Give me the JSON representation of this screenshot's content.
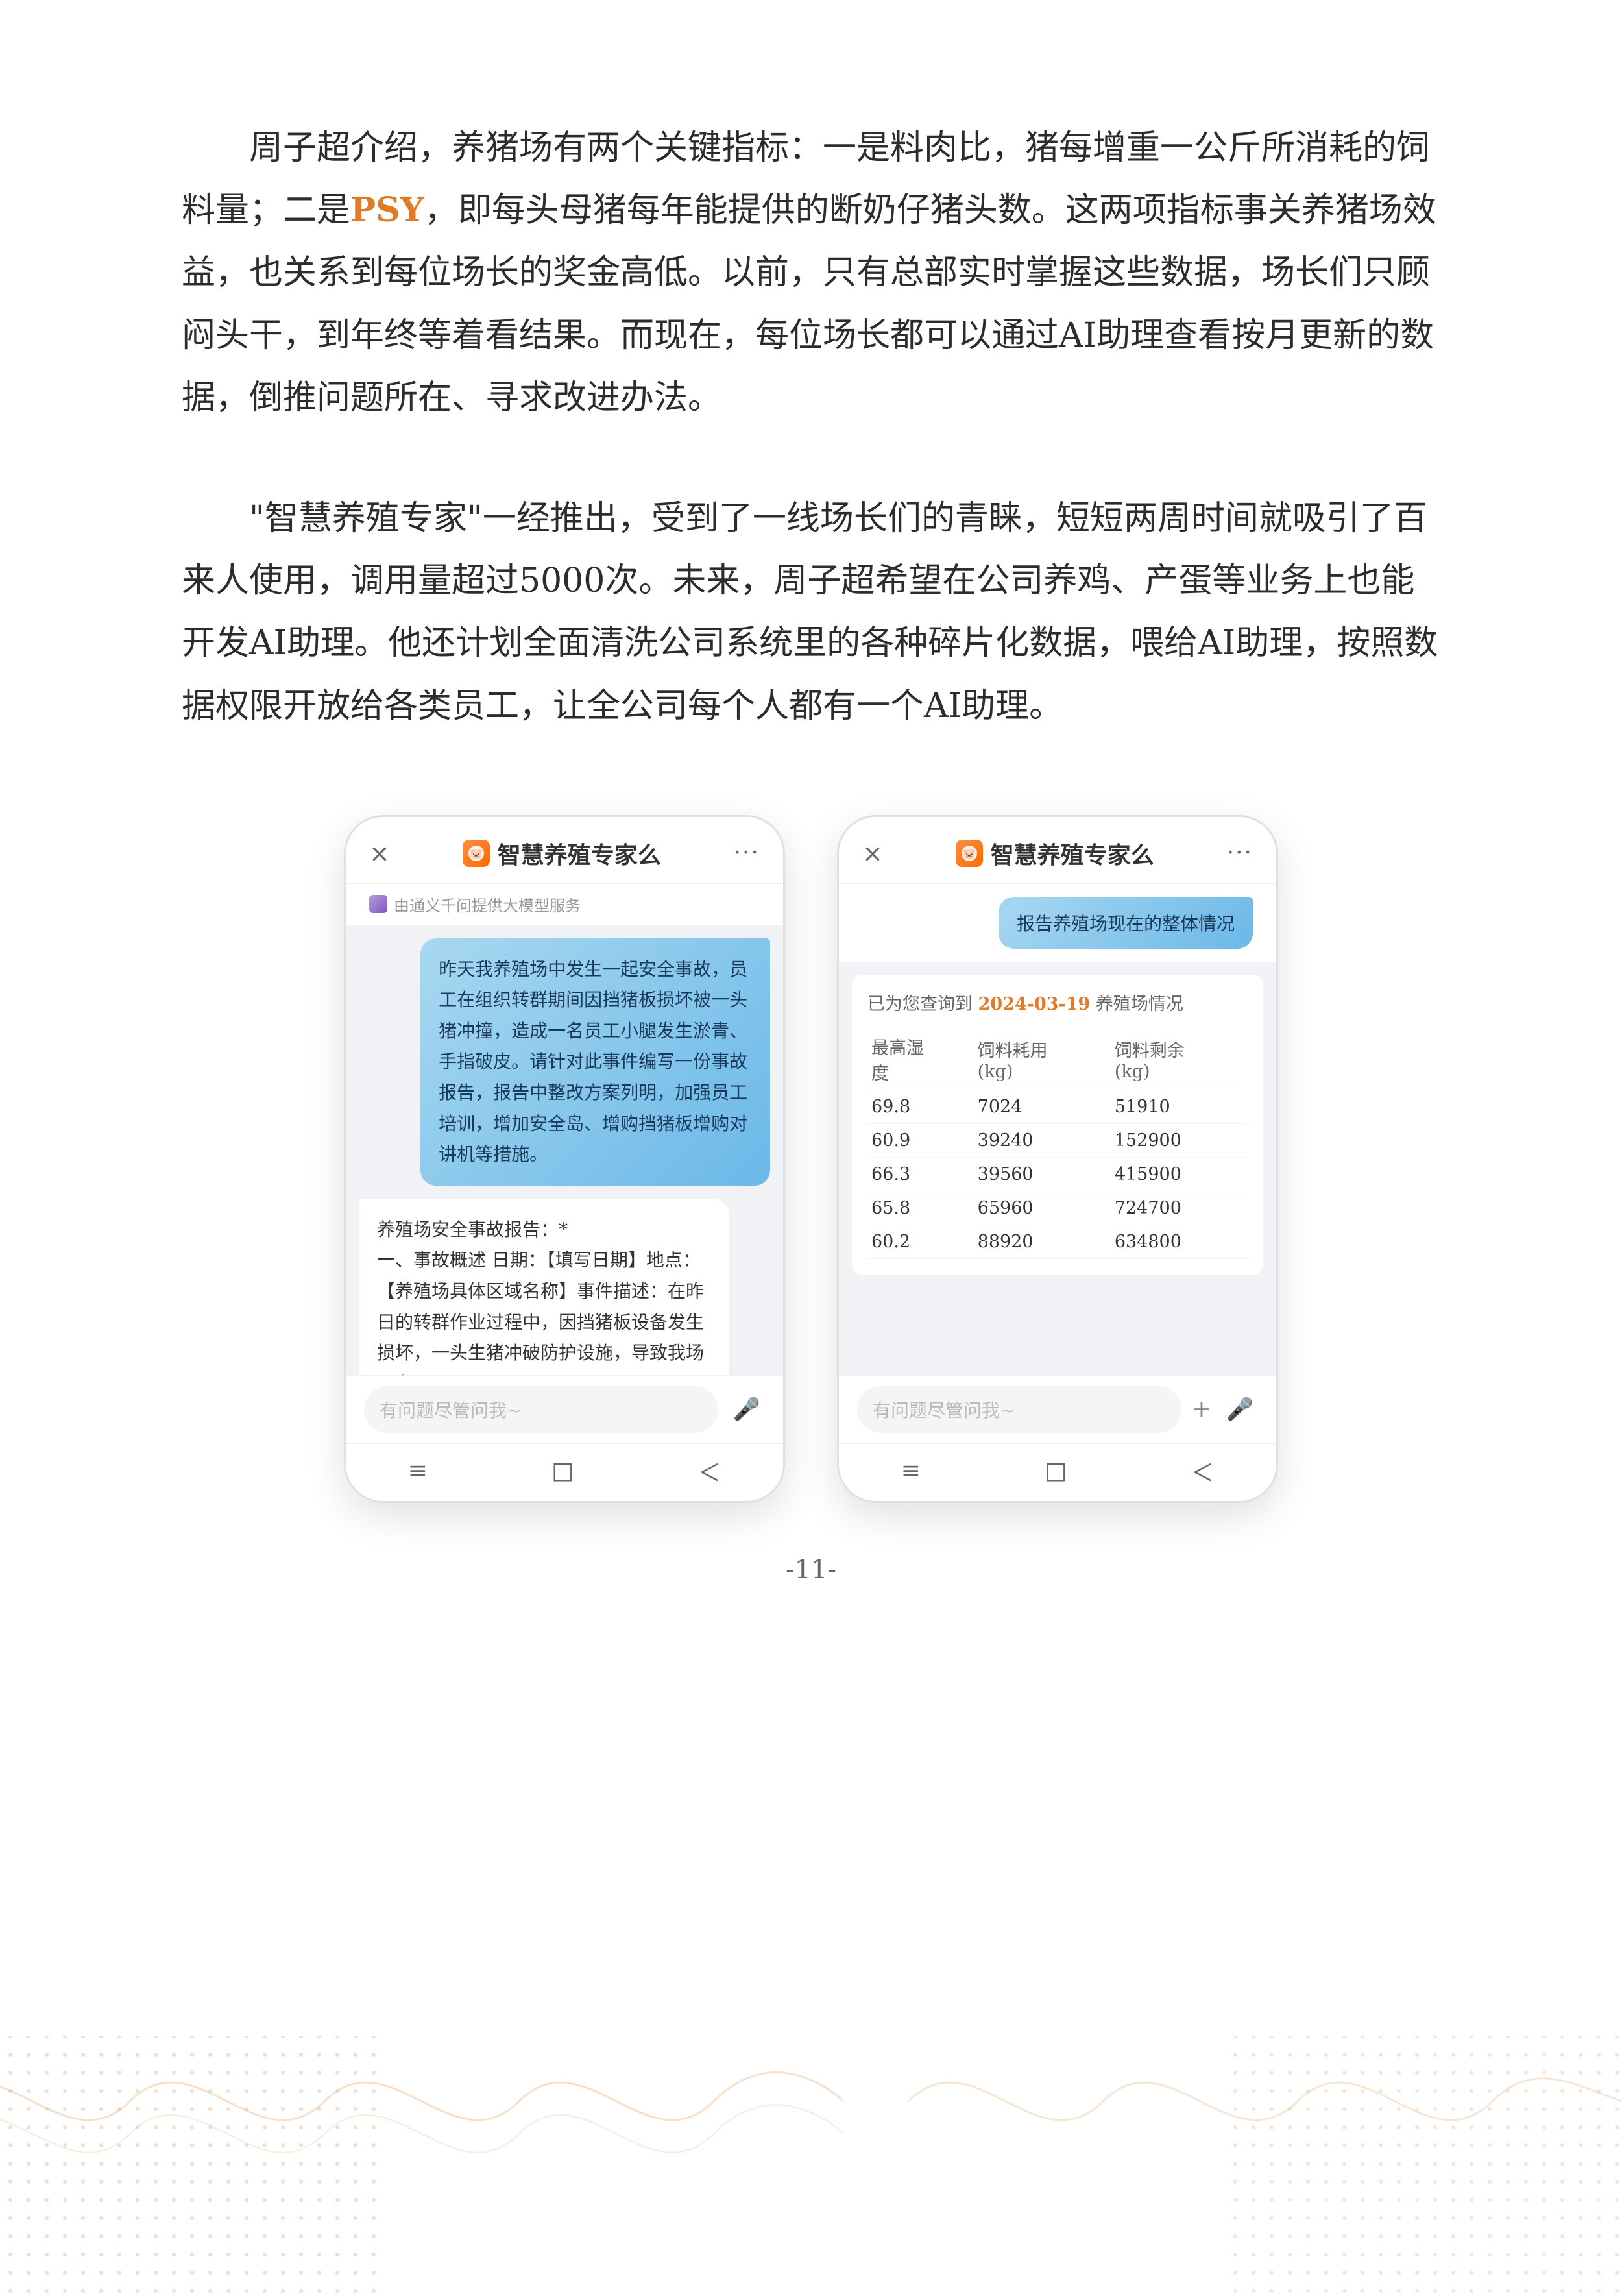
{
  "paragraphs": [
    {
      "id": "para1",
      "text": "周子超介绍，养猪场有两个关键指标：一是料肉比，猪每增重一公斤所消耗的饲料量；二是PSY，即每头母猪每年能提供的断奶仔猪头数。这两项指标事关养猪场效益，也关系到每位场长的奖金高低。以前，只有总部实时掌握这些数据，场长们只顾闷头干，到年终等着看结果。而现在，每位场长都可以通过AI助理查看按月更新的数据，倒推问题所在、寻求改进办法。",
      "highlights": [
        "PSY"
      ]
    },
    {
      "id": "para2",
      "text": "\"智慧养殖专家\"一经推出，受到了一线场长们的青睐，短短两周时间就吸引了百来人使用，调用量超过5000次。未来，周子超希望在公司养鸡、产蛋等业务上也能开发AI助理。他还计划全面清洗公司系统里的各种碎片化数据，喂给AI助理，按照数据权限开放给各类员工，让全公司每个人都有一个AI助理。"
    }
  ],
  "phone_left": {
    "title": "智慧养殖专家么",
    "powered_by": "由通义千问提供大模型服务",
    "close_icon": "×",
    "more_icon": "···",
    "user_message": "昨天我养殖场中发生一起安全事故，员工在组织转群期间因挡猪板损坏被一头猪冲撞，造成一名员工小腿发生淤青、手指破皮。请针对此事件编写一份事故报告，报告中整改方案列明，加强员工培训，增加安全岛、增购挡猪板增购对讲机等措施。",
    "ai_response": "养殖场安全事故报告：*\n一、事故概述 日期：【填写日期】地点：【养殖场具体区域名称】事件描述：在昨日的转群作业过程中，因挡猪板设备发生损坏，一头生猪冲破防护设施，导致我场一名…",
    "input_placeholder": "有问题尽管问我~",
    "nav_items": [
      "≡",
      "□",
      "＜"
    ]
  },
  "phone_right": {
    "title": "智慧养殖专家么",
    "close_icon": "×",
    "more_icon": "···",
    "query_bubble": "报告养殖场现在的整体情况",
    "result_header": "已为您查询到 2024-03-19 养殖场情况",
    "date_highlight": "2024-03-19",
    "table_columns": [
      "最高湿度",
      "饲料耗用(kg)",
      "饲料剩余(kg)"
    ],
    "table_rows": [
      [
        "69.8",
        "7024",
        "51910"
      ],
      [
        "60.9",
        "39240",
        "152900"
      ],
      [
        "66.3",
        "39560",
        "415900"
      ],
      [
        "65.8",
        "65960",
        "724700"
      ],
      [
        "60.2",
        "88920",
        "634800"
      ]
    ],
    "input_placeholder": "有问题尽管问我~",
    "nav_items": [
      "≡",
      "□",
      "＜"
    ]
  },
  "page_number": "-11-",
  "icons": {
    "mic": "🎤",
    "plus": "+",
    "pig_app": "🐷"
  }
}
